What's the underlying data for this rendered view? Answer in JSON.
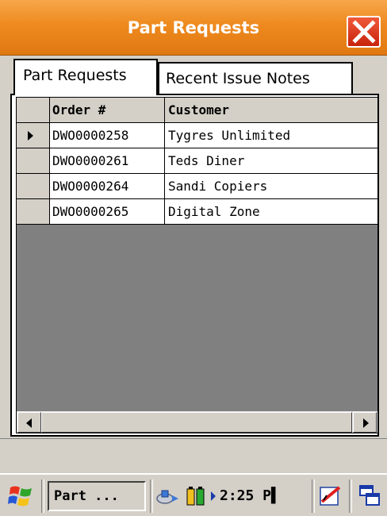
{
  "window": {
    "title": "Part Requests",
    "accent_color": "#ee8a1e"
  },
  "tabs": [
    {
      "label": "Part Requests",
      "selected": true
    },
    {
      "label": "Recent Issue Notes",
      "selected": false
    }
  ],
  "grid": {
    "columns": [
      "Order #",
      "Customer"
    ],
    "rows": [
      {
        "order": "DWO0000258",
        "customer": "Tygres Unlimited",
        "current": true
      },
      {
        "order": "DWO0000261",
        "customer": "Teds Diner",
        "current": false
      },
      {
        "order": "DWO0000264",
        "customer": "Sandi Copiers",
        "current": false
      },
      {
        "order": "DWO0000265",
        "customer": "Digital Zone",
        "current": false
      }
    ]
  },
  "taskbar": {
    "start_icon": "windows-flag-icon",
    "task_label": "Part ...",
    "tray_icons": [
      "network-icon",
      "battery-icon",
      "expand-arrow-icon",
      "input-panel-icon",
      "switch-windows-icon"
    ],
    "clock": "2:25 P▌"
  }
}
